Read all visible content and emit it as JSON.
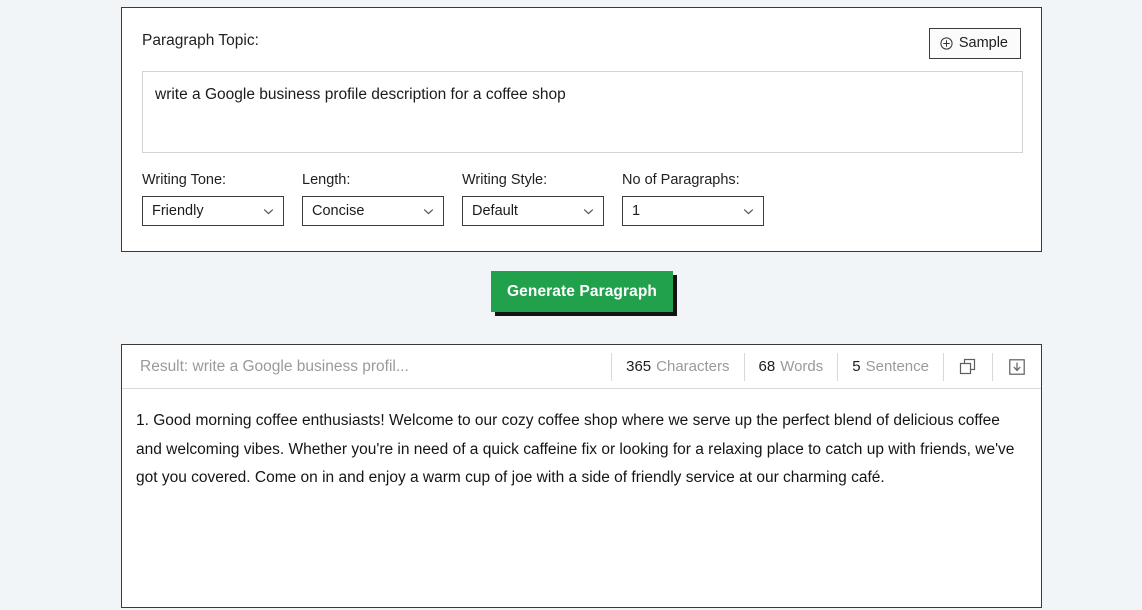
{
  "form": {
    "topic_label": "Paragraph Topic:",
    "sample_button": "Sample",
    "sample_icon": "plus-circle-icon",
    "topic_value": "write a Google business profile description for a coffee shop",
    "topic_placeholder": "",
    "controls": [
      {
        "label": "Writing Tone:",
        "value": "Friendly",
        "name": "writing-tone"
      },
      {
        "label": "Length:",
        "value": "Concise",
        "name": "length"
      },
      {
        "label": "Writing Style:",
        "value": "Default",
        "name": "writing-style"
      },
      {
        "label": "No of Paragraphs:",
        "value": "1",
        "name": "no-of-paragraphs"
      }
    ]
  },
  "generate": {
    "label": "Generate Paragraph",
    "color": "#22a14d",
    "text_color": "#ffffff",
    "shadow_color": "#141414"
  },
  "result": {
    "title": "Result: write a Google business profil...",
    "stats": [
      {
        "number": "365",
        "label": "Characters"
      },
      {
        "number": "68",
        "label": "Words"
      },
      {
        "number": "5",
        "label": "Sentence"
      }
    ],
    "copy_icon": "copy-icon",
    "download_icon": "download-box-icon",
    "text": "1. Good morning coffee enthusiasts! Welcome to our cozy coffee shop where we serve up the perfect blend of delicious coffee and welcoming vibes. Whether you're in need of a quick caffeine fix or looking for a relaxing place to catch up with friends, we've got you covered. Come on in and enjoy a warm cup of joe with a side of friendly service at our charming café."
  },
  "theme": {
    "page_background": "#f2f5f8",
    "panel_background": "#ffffff",
    "panel_border": "#3a3a3a",
    "muted_text": "#9a9a9a"
  }
}
